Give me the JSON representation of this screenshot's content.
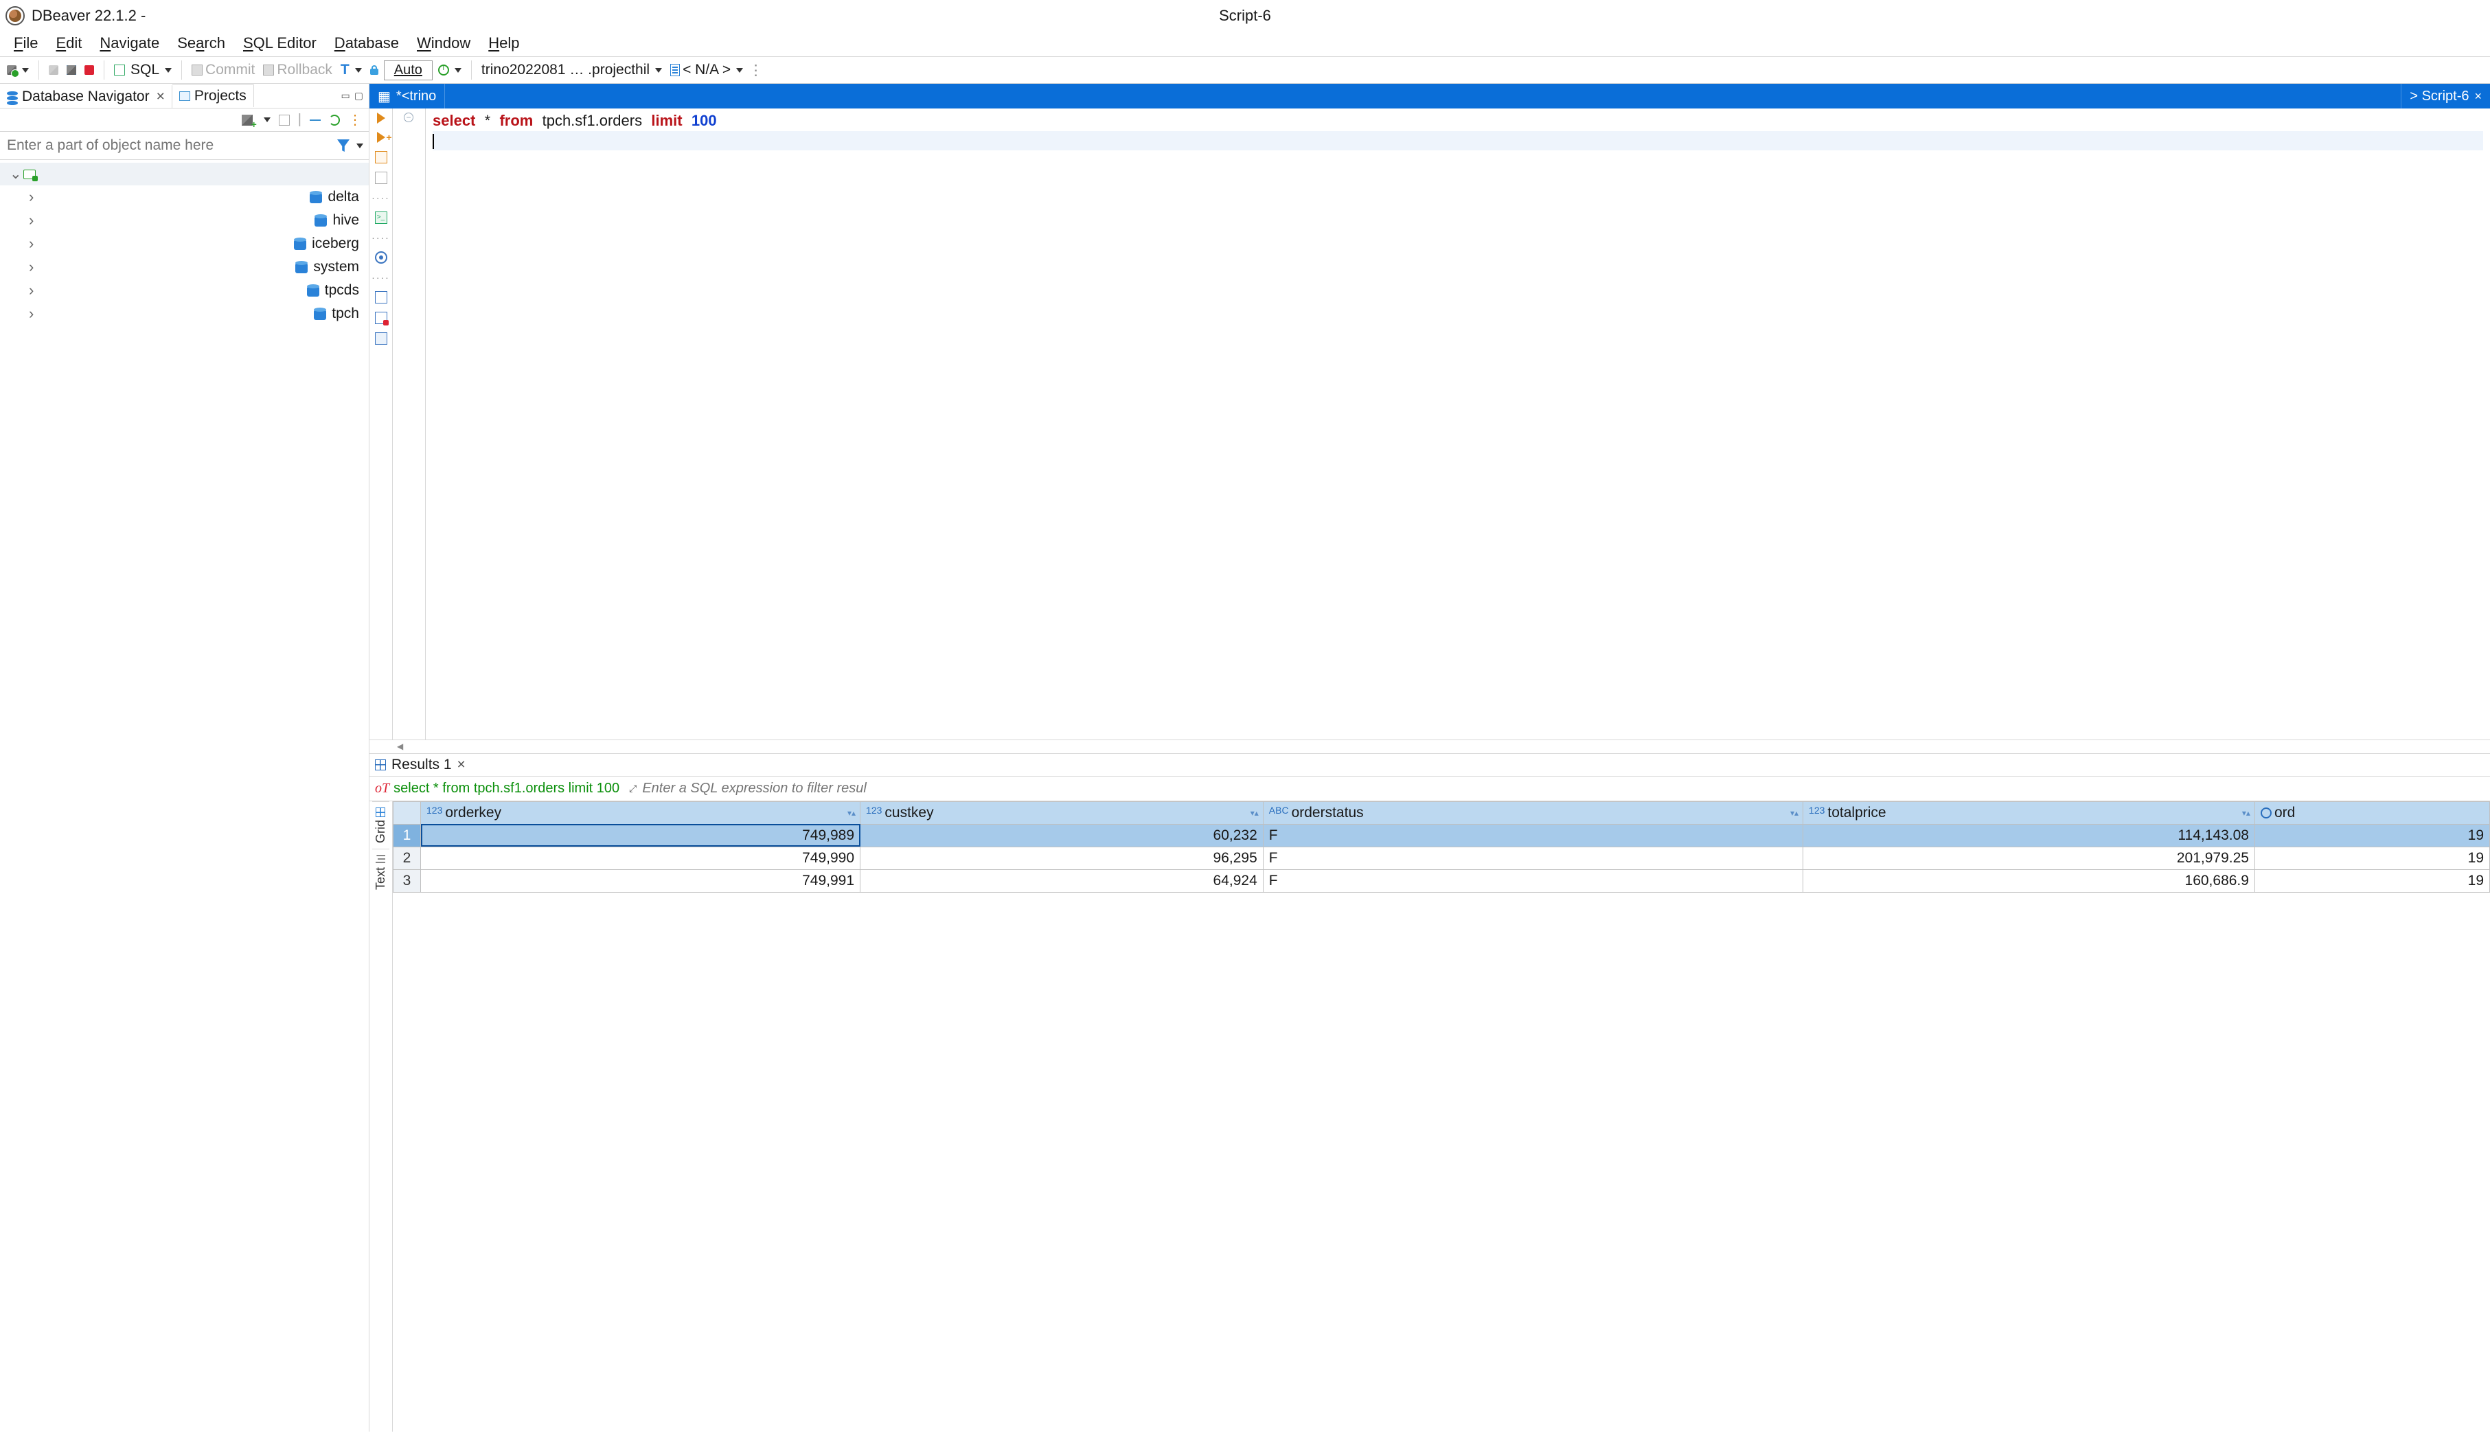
{
  "title": {
    "app": "DBeaver 22.1.2 -",
    "script": "Script-6"
  },
  "menu": {
    "file": "File",
    "edit": "Edit",
    "navigate": "Navigate",
    "search": "Search",
    "sql": "SQL Editor",
    "database": "Database",
    "window": "Window",
    "help": "Help"
  },
  "toolbar": {
    "sql": "SQL",
    "commit": "Commit",
    "rollback": "Rollback",
    "auto": "Auto",
    "conn": "trino2022081 … .projecthil",
    "schema": "< N/A >"
  },
  "left_tabs": {
    "nav": "Database Navigator",
    "projects": "Projects"
  },
  "nav_filter_placeholder": "Enter a part of object name here",
  "tree": {
    "items": [
      "delta",
      "hive",
      "iceberg",
      "system",
      "tpcds",
      "tpch"
    ]
  },
  "editor_tabs": {
    "left": "*<trino",
    "right": "> Script-6"
  },
  "sql": {
    "tokens": {
      "select": "select",
      "star": "*",
      "from": "from",
      "table": "tpch.sf1.orders",
      "limit": "limit",
      "n": "100"
    }
  },
  "results": {
    "tab": "Results 1",
    "query": "select * from tpch.sf1.orders limit 100",
    "filter_placeholder": "Enter a SQL expression to filter resul",
    "side_tabs": {
      "grid": "Grid",
      "text": "Text"
    },
    "columns": [
      {
        "name": "orderkey",
        "type": "123"
      },
      {
        "name": "custkey",
        "type": "123"
      },
      {
        "name": "orderstatus",
        "type": "ABC"
      },
      {
        "name": "totalprice",
        "type": "123"
      },
      {
        "name": "ord",
        "type": "clock"
      }
    ],
    "rows": [
      {
        "n": 1,
        "orderkey": "749,989",
        "custkey": "60,232",
        "orderstatus": "F",
        "totalprice": "114,143.08",
        "ord": "19"
      },
      {
        "n": 2,
        "orderkey": "749,990",
        "custkey": "96,295",
        "orderstatus": "F",
        "totalprice": "201,979.25",
        "ord": "19"
      },
      {
        "n": 3,
        "orderkey": "749,991",
        "custkey": "64,924",
        "orderstatus": "F",
        "totalprice": "160,686.9",
        "ord": "19"
      }
    ]
  }
}
